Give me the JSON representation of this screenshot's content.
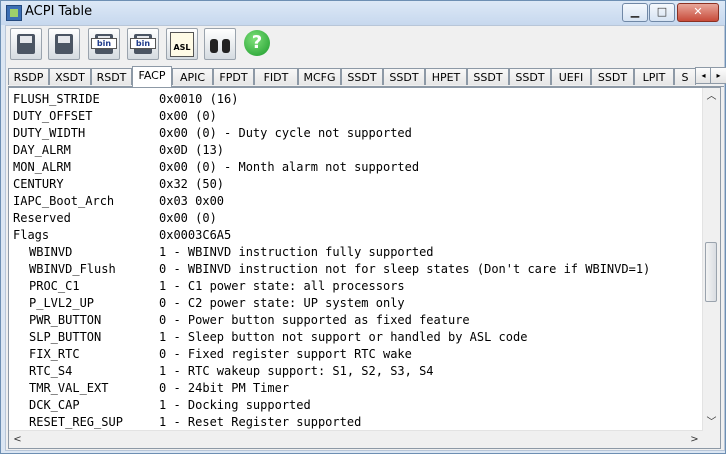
{
  "window": {
    "title": "ACPI Table",
    "minimize_glyph": "▁",
    "maximize_glyph": "□",
    "close_glyph": "✕"
  },
  "toolbar": {
    "buttons": [
      {
        "icon": "save-disk-icon",
        "label": ""
      },
      {
        "icon": "save-all-icon",
        "label": ""
      },
      {
        "icon": "save-binary-icon",
        "label": "bin"
      },
      {
        "icon": "save-all-binary-icon",
        "label": "bin"
      },
      {
        "icon": "asl-icon",
        "label": "ASL"
      },
      {
        "icon": "binoculars-icon",
        "label": ""
      },
      {
        "icon": "help-icon",
        "label": "?"
      }
    ]
  },
  "tabs": {
    "items": [
      "RSDP",
      "XSDT",
      "RSDT",
      "FACP",
      "APIC",
      "FPDT",
      "FIDT",
      "MCFG",
      "SSDT",
      "SSDT",
      "HPET",
      "SSDT",
      "SSDT",
      "UEFI",
      "SSDT",
      "LPIT",
      "S"
    ],
    "active_index": 3,
    "scroll_left_glyph": "◂",
    "scroll_right_glyph": "▸"
  },
  "content": {
    "lines": [
      {
        "field": "FLUSH_STRIDE",
        "value": "0x0010 (16)",
        "indent": false
      },
      {
        "field": "DUTY_OFFSET",
        "value": "0x00 (0)",
        "indent": false
      },
      {
        "field": "DUTY_WIDTH",
        "value": "0x00 (0) - Duty cycle not supported",
        "indent": false
      },
      {
        "field": "DAY_ALRM",
        "value": "0x0D (13)",
        "indent": false
      },
      {
        "field": "MON_ALRM",
        "value": "0x00 (0) - Month alarm not supported",
        "indent": false
      },
      {
        "field": "CENTURY",
        "value": "0x32 (50)",
        "indent": false
      },
      {
        "field": "IAPC_Boot_Arch",
        "value": "0x03 0x00",
        "indent": false
      },
      {
        "field": "Reserved",
        "value": "0x00 (0)",
        "indent": false
      },
      {
        "field": "Flags",
        "value": "0x0003C6A5",
        "indent": false
      },
      {
        "field": "WBINVD",
        "value": "1 - WBINVD instruction fully supported",
        "indent": true
      },
      {
        "field": "WBINVD_Flush",
        "value": "0 - WBINVD instruction not for sleep states (Don't care if WBINVD=1)",
        "indent": true
      },
      {
        "field": "PROC_C1",
        "value": "1 - C1 power state: all processors",
        "indent": true
      },
      {
        "field": "P_LVL2_UP",
        "value": "0 - C2 power state: UP system only",
        "indent": true
      },
      {
        "field": "PWR_BUTTON",
        "value": "0 - Power button supported as fixed feature",
        "indent": true
      },
      {
        "field": "SLP_BUTTON",
        "value": "1 - Sleep button not support or handled by ASL code",
        "indent": true
      },
      {
        "field": "FIX_RTC",
        "value": "0 - Fixed register support RTC wake",
        "indent": true
      },
      {
        "field": "RTC_S4",
        "value": "1 - RTC wakeup support: S1, S2, S3, S4",
        "indent": true
      },
      {
        "field": "TMR_VAL_EXT",
        "value": "0 - 24bit PM Timer",
        "indent": true
      },
      {
        "field": "DCK_CAP",
        "value": "1 - Docking supported",
        "indent": true
      },
      {
        "field": "RESET_REG_SUP",
        "value": "1 - Reset Register supported",
        "indent": true
      }
    ]
  },
  "scrollbars": {
    "vertical_position": 0.55,
    "up_glyph": "︿",
    "down_glyph": "﹀",
    "left_glyph": "<",
    "right_glyph": ">"
  }
}
